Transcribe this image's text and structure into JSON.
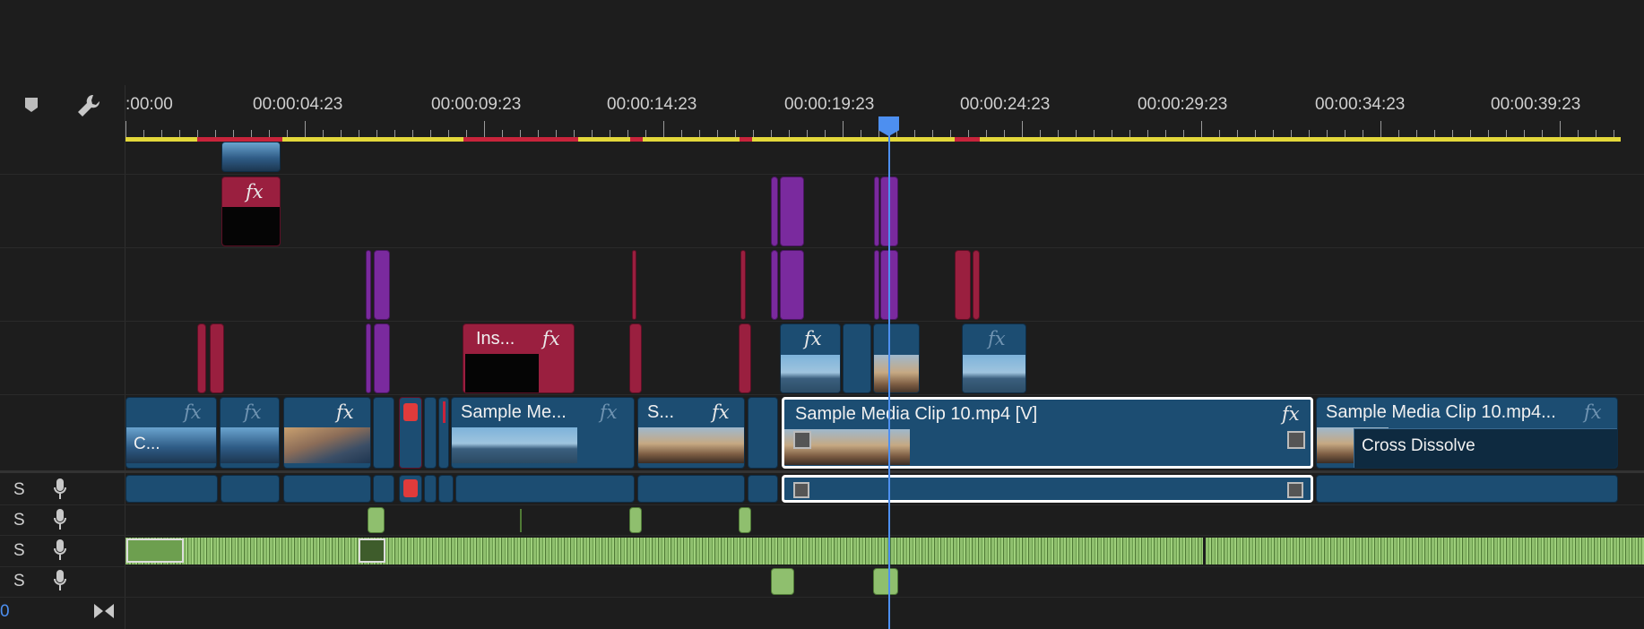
{
  "timeline": {
    "timecodes": [
      "00:00",
      "00:00:04:23",
      "00:00:09:23",
      "00:00:14:23",
      "00:00:19:23",
      "00:00:24:23",
      "00:00:29:23",
      "00:00:34:23",
      "00:00:39:23"
    ],
    "timecode_prefix": ":"
  },
  "header": {
    "marker_icon": "marker-icon",
    "settings_icon": "wrench-icon"
  },
  "clips": {
    "fx_label": "fx",
    "v1_c": "C...",
    "v1_sample_me": "Sample Me...",
    "v1_s": "S...",
    "v1_clip10": "Sample Media Clip 10.mp4 [V]",
    "v1_clip10b": "Sample Media Clip 10.mp4...",
    "transition": "Cross Dissolve",
    "ins": "Ins..."
  },
  "audio_tracks": [
    {
      "label": "S"
    },
    {
      "label": "S"
    },
    {
      "label": "S"
    },
    {
      "label": "S"
    }
  ],
  "footer": {
    "value": "0"
  },
  "colors": {
    "work_area": "#e3d83a",
    "render_red": "#c8243b",
    "playhead": "#4d8ff0",
    "video_clip": "#1c4d72",
    "purple_clip": "#7a2a9e",
    "red_clip": "#9a1f3f",
    "audio_green": "#8fbf6e"
  }
}
